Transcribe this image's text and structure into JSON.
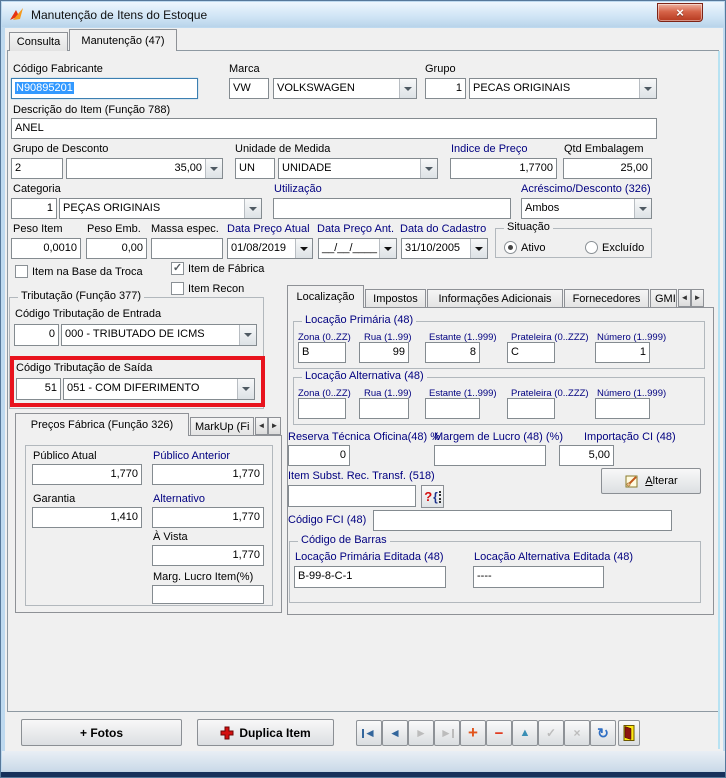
{
  "window": {
    "title": "Manutenção de Itens do Estoque",
    "close_glyph": "×"
  },
  "top_tabs": {
    "consulta": "Consulta",
    "manutencao": "Manutenção (47)"
  },
  "fields": {
    "codigo_fabricante": {
      "label": "Código Fabricante",
      "value": "N90895201"
    },
    "marca": {
      "label": "Marca",
      "code": "VW",
      "name": "VOLKSWAGEN"
    },
    "grupo": {
      "label": "Grupo",
      "code": "1",
      "name": "PECAS ORIGINAIS"
    },
    "descricao": {
      "label": "Descrição do Item (Função 788)",
      "value": "ANEL"
    },
    "grupo_desconto": {
      "label": "Grupo de Desconto",
      "code": "2",
      "value": "35,00"
    },
    "unidade": {
      "label": "Unidade de Medida",
      "code": "UN",
      "name": "UNIDADE"
    },
    "indice_preco": {
      "label": "Indice de Preço",
      "value": "1,7700"
    },
    "qtd_embalagem": {
      "label": "Qtd Embalagem",
      "value": "25,00"
    },
    "categoria": {
      "label": "Categoria",
      "code": "1",
      "name": "PEÇAS ORIGINAIS"
    },
    "utilizacao": {
      "label": "Utilização",
      "value": ""
    },
    "acrescimo": {
      "label": "Acréscimo/Desconto (326)",
      "value": "Ambos"
    },
    "peso_item": {
      "label": "Peso Item",
      "value": "0,0010"
    },
    "peso_emb": {
      "label": "Peso Emb.",
      "value": "0,00"
    },
    "massa": {
      "label": "Massa espec.",
      "value": ""
    },
    "data_preco_atual": {
      "label": "Data Preço Atual",
      "value": "01/08/2019"
    },
    "data_preco_ant": {
      "label": "Data Preço Ant.",
      "value": "__/__/____"
    },
    "data_cadastro": {
      "label": "Data do Cadastro",
      "value": "31/10/2005"
    }
  },
  "situacao": {
    "title": "Situação",
    "ativo": "Ativo",
    "excluido": "Excluído"
  },
  "checks": {
    "base_troca": "Item na Base da Troca",
    "fabrica": "Item de Fábrica",
    "recon": "Item Recon",
    "check_glyph": "✓"
  },
  "tributacao": {
    "title": "Tributação (Função 377)",
    "entrada_label": "Código Tributação de Entrada",
    "entrada_code": "0",
    "entrada_value": "000 - TRIBUTADO DE ICMS",
    "saida_label": "Código Tributação de Saída",
    "saida_code": "51",
    "saida_value": "051 - COM DIFERIMENTO"
  },
  "precos": {
    "tab": "Preços Fábrica (Função 326)",
    "tab_markup": "MarkUp (Fi",
    "publico_atual_label": "Público Atual",
    "publico_atual": "1,770",
    "publico_anterior_label": "Público Anterior",
    "publico_anterior": "1,770",
    "garantia_label": "Garantia",
    "garantia": "1,410",
    "alternativo_label": "Alternativo",
    "alternativo": "1,770",
    "a_vista_label": "À Vista",
    "a_vista": "1,770",
    "marg_lucro_label": "Marg. Lucro Item(%)",
    "marg_lucro": ""
  },
  "right_tabs": {
    "localizacao": "Localização",
    "impostos": "Impostos",
    "informacoes": "Informações Adicionais",
    "fornecedores": "Fornecedores",
    "gmi": "GMI"
  },
  "loc_prim": {
    "title": "Locação Primária (48)",
    "labels": [
      "Zona (0..ZZ)",
      "Rua (1..99)",
      "Estante (1..999)",
      "Prateleira (0..ZZZ)",
      "Número (1..999)"
    ],
    "values": [
      "B",
      "99",
      "8",
      "C",
      "1"
    ]
  },
  "loc_alt": {
    "title": "Locação Alternativa (48)",
    "labels": [
      "Zona (0..ZZ)",
      "Rua (1..99)",
      "Estante (1..999)",
      "Prateleira (0..ZZZ)",
      "Número (1..999)"
    ],
    "values": [
      "",
      "",
      "",
      "",
      ""
    ]
  },
  "extras": {
    "reserva_label": "Reserva Técnica Oficina(48) %",
    "reserva": "0",
    "margem_label": "Margem de Lucro (48) (%)",
    "margem": "",
    "importacao_label": "Importação CI (48)",
    "importacao": "5,00",
    "item_subst_label": "Item Subst. Rec. Transf. (518)",
    "item_subst": "",
    "lookup_q": "?",
    "lookup_brace": "{",
    "alterar": "Alterar",
    "fci_label": "Código FCI (48)",
    "fci": ""
  },
  "barras": {
    "title": "Código de Barras",
    "prim_label": "Locação Primária Editada (48)",
    "prim": "B-99-8-C-1",
    "alt_label": "Locação Alternativa Editada (48)",
    "alt": "----"
  },
  "bottom": {
    "fotos": "+ Fotos",
    "duplica": "Duplica Item"
  },
  "nav": {
    "glyphs": {
      "first": "◄",
      "prior": "◄",
      "next": "►",
      "last": "►",
      "insert": "+",
      "delete": "−",
      "edit": "▲",
      "post": "✓",
      "cancel": "×",
      "refresh": "↻"
    }
  },
  "colors": {
    "label_blue": "#000080",
    "annotation_red": "#e8131d",
    "selection_blue": "#3399ff"
  }
}
